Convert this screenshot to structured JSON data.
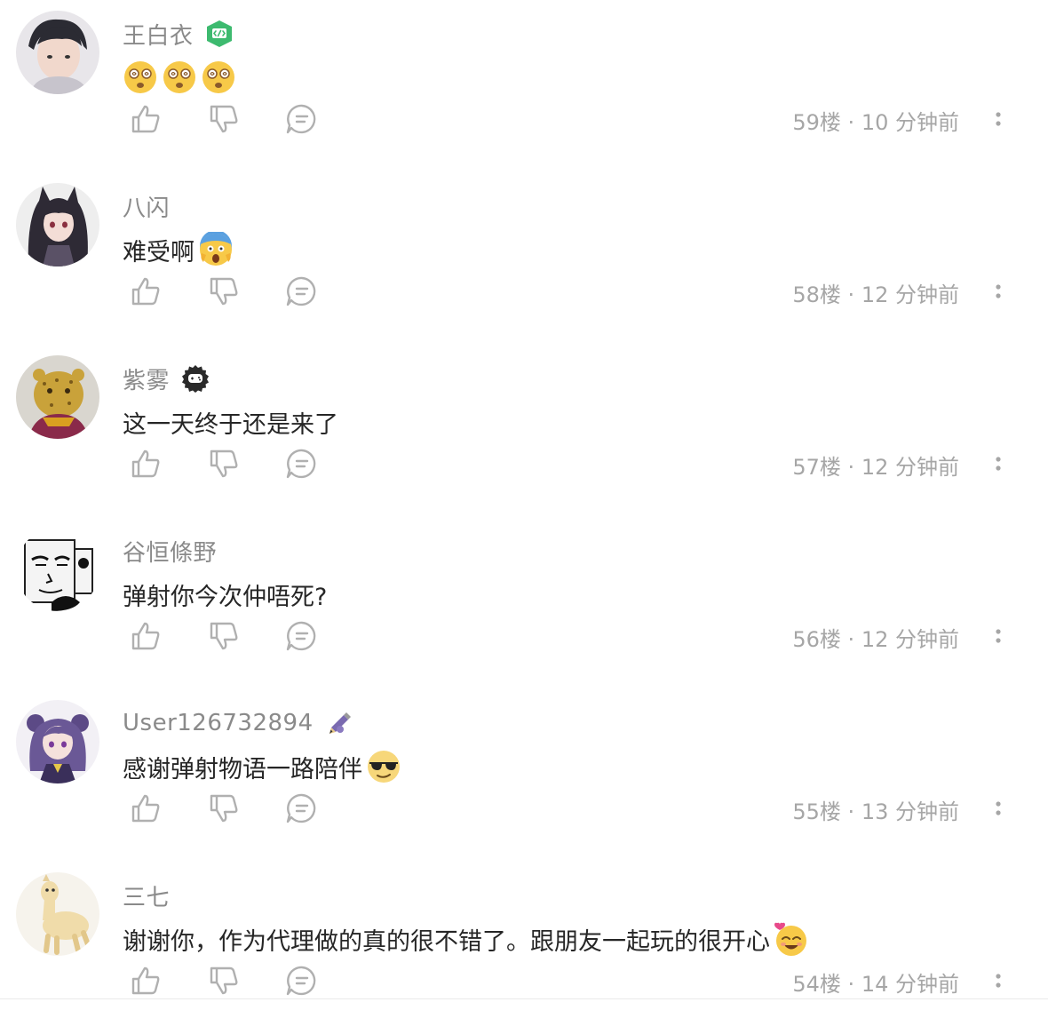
{
  "comments": [
    {
      "username": "王白衣",
      "text": "",
      "emojis": [
        "dizzy-face",
        "dizzy-face",
        "dizzy-face"
      ],
      "badge": "developer-badge",
      "floor": "59楼",
      "time": "10 分钟前"
    },
    {
      "username": "八闪",
      "text": "难受啊",
      "emojis": [
        "screaming-face"
      ],
      "badge": "",
      "floor": "58楼",
      "time": "12 分钟前"
    },
    {
      "username": "紫雾",
      "text": "这一天终于还是来了",
      "emojis": [],
      "badge": "gamepad-badge",
      "floor": "57楼",
      "time": "12 分钟前"
    },
    {
      "username": "谷恒條野",
      "text": "弹射你今次仲唔死?",
      "emojis": [],
      "badge": "",
      "floor": "56楼",
      "time": "12 分钟前"
    },
    {
      "username": "User126732894",
      "text": "感谢弹射物语一路陪伴",
      "emojis": [
        "sunglasses-face"
      ],
      "badge": "pencil-badge",
      "floor": "55楼",
      "time": "13 分钟前"
    },
    {
      "username": "三七",
      "text": "谢谢你，作为代理做的真的很不错了。跟朋友一起玩的很开心",
      "emojis": [
        "smiling-heart-face"
      ],
      "badge": "",
      "floor": "54楼",
      "time": "14 分钟前"
    }
  ],
  "meta_separator": "·",
  "colors": {
    "username": "#8a8a8a",
    "text": "#262626",
    "meta": "#a6a6a6",
    "icon": "#b0b0b0",
    "developer_badge": "#3dba6f"
  }
}
